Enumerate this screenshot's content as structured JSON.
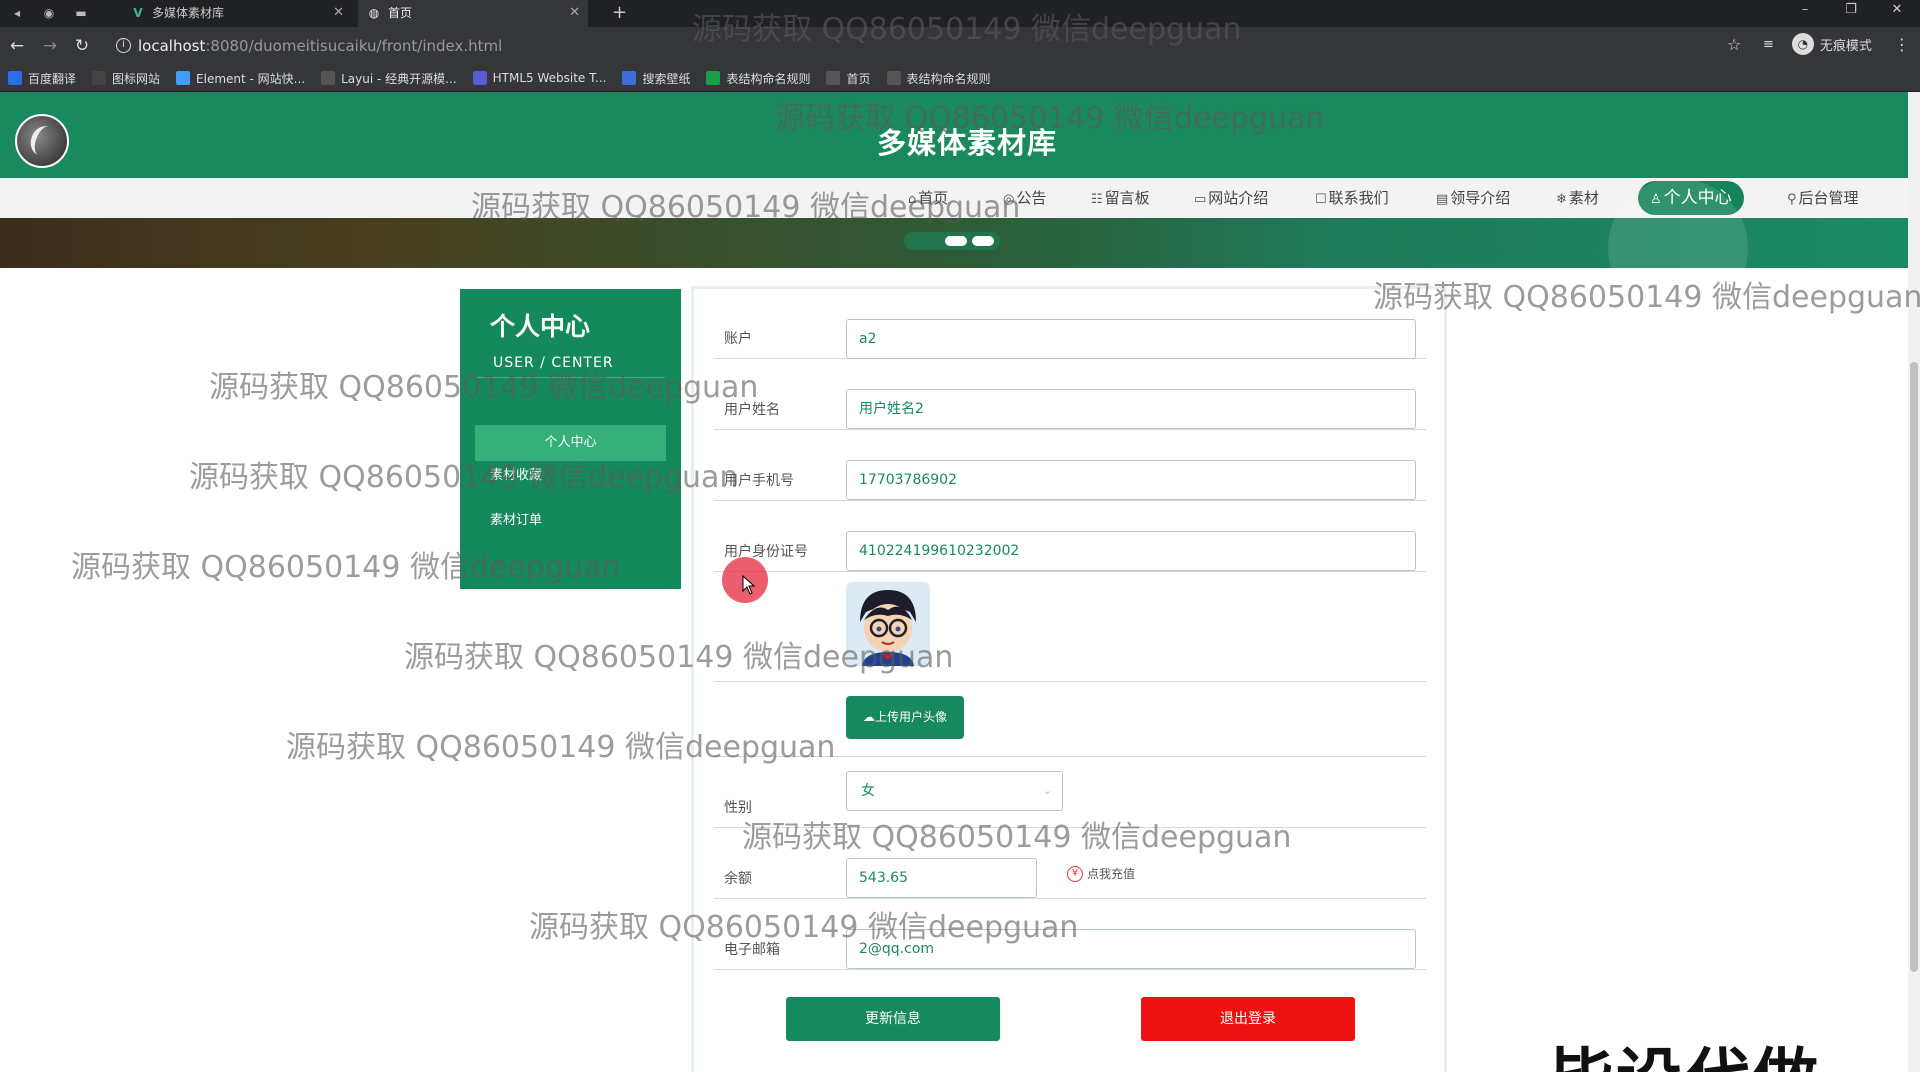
{
  "browser": {
    "tabs": [
      {
        "title": "多媒体素材库",
        "active": false
      },
      {
        "title": "首页",
        "active": true
      }
    ],
    "url_host": "localhost",
    "url_path": ":8080/duomeitisucaiku/front/index.html",
    "profile_label": "无痕模式",
    "bookmarks": [
      {
        "label": "百度翻译",
        "color": "#2b6de8"
      },
      {
        "label": "图标网站",
        "color": "#444"
      },
      {
        "label": "Element - 网站快...",
        "color": "#409eff"
      },
      {
        "label": "Layui - 经典开源模...",
        "color": "#555"
      },
      {
        "label": "HTML5 Website T...",
        "color": "#5b5bd6"
      },
      {
        "label": "搜索壁纸",
        "color": "#3b6fd8"
      },
      {
        "label": "表结构命名规则",
        "color": "#1a9e4a"
      },
      {
        "label": "首页",
        "color": "#555"
      },
      {
        "label": "表结构命名规则",
        "color": "#555"
      }
    ]
  },
  "site": {
    "title": "多媒体素材库",
    "nav": [
      {
        "icon": "⌂",
        "label": "首页"
      },
      {
        "icon": "◎",
        "label": "公告"
      },
      {
        "icon": "☷",
        "label": "留言板"
      },
      {
        "icon": "▭",
        "label": "网站介绍"
      },
      {
        "icon": "☐",
        "label": "联系我们"
      },
      {
        "icon": "▤",
        "label": "领导介绍"
      },
      {
        "icon": "❄",
        "label": "素材"
      },
      {
        "icon": "♙",
        "label": "个人中心",
        "active": true
      },
      {
        "icon": "⚲",
        "label": "后台管理"
      }
    ]
  },
  "sidebar": {
    "title": "个人中心",
    "subtitle": "USER / CENTER",
    "items": [
      {
        "label": "个人中心",
        "active": true
      },
      {
        "label": "素材收藏"
      },
      {
        "label": "素材订单"
      }
    ]
  },
  "form": {
    "account": {
      "label": "账户",
      "value": "a2"
    },
    "name": {
      "label": "用户姓名",
      "value": "用户姓名2"
    },
    "phone": {
      "label": "用户手机号",
      "value": "17703786902"
    },
    "idcard": {
      "label": "用户身份证号",
      "value": "410224199610232002"
    },
    "upload_label": "上传用户头像",
    "gender": {
      "label": "性别",
      "value": "女"
    },
    "balance": {
      "label": "余额",
      "value": "543.65",
      "recharge_label": "点我充值"
    },
    "email": {
      "label": "电子邮箱",
      "value": "2@qq.com"
    },
    "update_button": "更新信息",
    "logout_button": "退出登录"
  },
  "overlay": {
    "watermark": "源码获取 QQ86050149 微信deepguan",
    "corner_text": "毕设代做"
  },
  "colors": {
    "brand": "#1a8a5e",
    "danger": "#ee1111"
  }
}
